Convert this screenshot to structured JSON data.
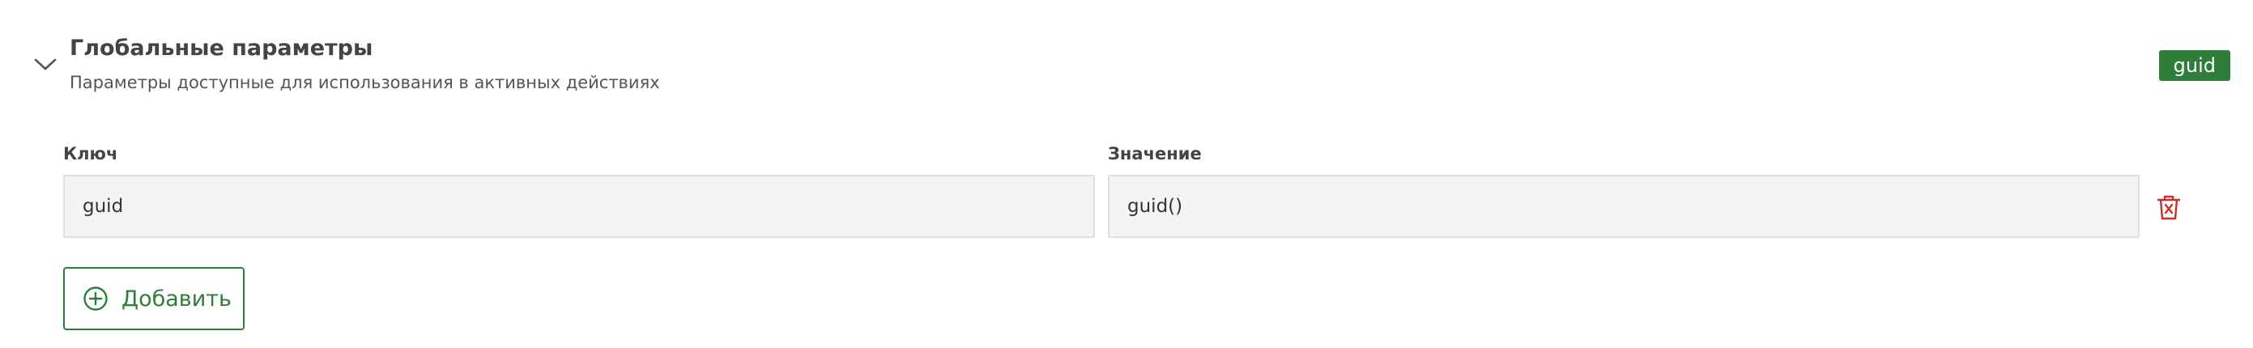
{
  "section": {
    "title": "Глобальные параметры",
    "subtitle": "Параметры доступные для использования в активных действиях",
    "badge": "guid",
    "expand_icon": "chevron-down-icon"
  },
  "fields": {
    "key_label": "Ключ",
    "value_label": "Значение",
    "rows": [
      {
        "key": "guid",
        "value": "guid()"
      }
    ],
    "delete_icon": "trash-icon"
  },
  "actions": {
    "add_label": "Добавить",
    "add_icon": "plus-circle-icon"
  },
  "colors": {
    "accent": "#2f7d3a",
    "danger": "#c9302c",
    "input_bg": "#f3f4f6",
    "input_border": "#dcdfe3"
  }
}
